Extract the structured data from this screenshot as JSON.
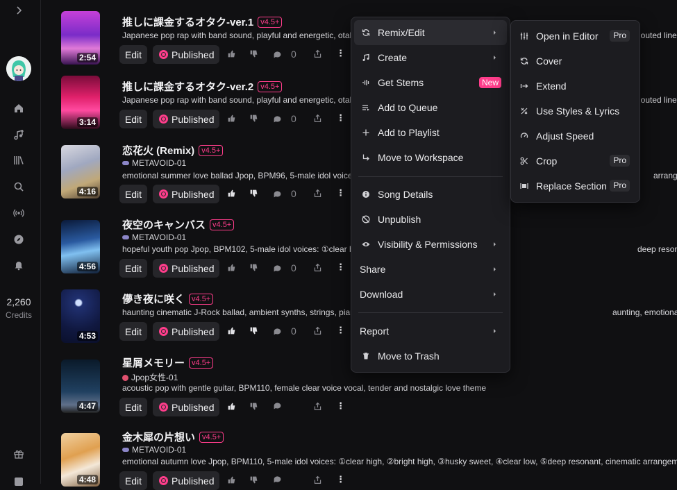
{
  "sidebar": {
    "items": [
      {
        "icon": "expand-chevron-icon"
      },
      {
        "icon": "home-icon"
      },
      {
        "icon": "create-music-icon"
      },
      {
        "icon": "library-icon"
      },
      {
        "icon": "search-icon"
      },
      {
        "icon": "radio-icon"
      },
      {
        "icon": "explore-compass-icon"
      },
      {
        "icon": "notifications-bell-icon"
      },
      {
        "icon": "gift-icon"
      },
      {
        "icon": "bottom-menu-icon"
      }
    ],
    "credits_value": "2,260",
    "credits_label": "Credits"
  },
  "songs": [
    {
      "title": "推しに課金するオタク-ver.1",
      "version": "v4.5+",
      "artist": "",
      "description": "Japanese pop rap with band sound, playful and energetic, otaku p",
      "description_tail": "houted lines",
      "duration": "2:54",
      "edit_label": "Edit",
      "published_label": "Published",
      "likes": "",
      "comments": "0"
    },
    {
      "title": "推しに課金するオタク-ver.2",
      "version": "v4.5+",
      "artist": "",
      "description": "Japanese pop rap with band sound, playful and energetic, otaku p",
      "description_tail": "houted lines",
      "duration": "3:14",
      "edit_label": "Edit",
      "published_label": "Published",
      "likes": "",
      "comments": "0"
    },
    {
      "title": "恋花火 (Remix)",
      "version": "v4.5+",
      "artist": "METAVOID-01",
      "description": "emotional summer love ballad Jpop, BPM96, 5-male idol voices: ①",
      "description_tail": "arrangeme",
      "duration": "4:16",
      "edit_label": "Edit",
      "published_label": "Published",
      "likes": "",
      "comments": "0"
    },
    {
      "title": "夜空のキャンバス",
      "version": "v4.5+",
      "artist": "METAVOID-01",
      "description": "hopeful youth pop Jpop, BPM102, 5-male idol voices: ①clear high",
      "description_tail": "deep resonant, cinematic arrangement, Chorus s",
      "duration": "4:56",
      "edit_label": "Edit",
      "published_label": "Published",
      "likes": "",
      "comments": "0"
    },
    {
      "title": "儚き夜に咲く",
      "version": "v4.5+",
      "artist": "",
      "description": "haunting cinematic J-Rock ballad, ambient synths, strings, piano, l",
      "description_tail": "aunting, emotionally intense J-rock ballad fused wi",
      "duration": "4:53",
      "edit_label": "Edit",
      "published_label": "Published",
      "likes": "",
      "comments": "0"
    },
    {
      "title": "星屑メモリー",
      "version": "v4.5+",
      "artist": "Jpop女性-01",
      "description": "acoustic pop with gentle guitar, BPM110, female clear voice vocal, tender and nostalgic love theme",
      "description_tail": "",
      "duration": "4:47",
      "edit_label": "Edit",
      "published_label": "Published",
      "likes": "",
      "comments": ""
    },
    {
      "title": "金木犀の片想い",
      "version": "v4.5+",
      "artist": "METAVOID-01",
      "description": "emotional autumn love Jpop, BPM110, 5-male idol voices: ①clear high, ②bright high, ③husky sweet, ④clear low, ⑤deep resonant, cinematic arrangement, Chor",
      "description_tail": "",
      "duration": "4:48",
      "edit_label": "Edit",
      "published_label": "Published",
      "likes": "",
      "comments": ""
    }
  ],
  "context_menu": {
    "items": [
      {
        "label": "Remix/Edit",
        "icon": "remix-icon",
        "submenu": true,
        "highlighted": true
      },
      {
        "label": "Create",
        "icon": "music-note-icon",
        "submenu": true
      },
      {
        "label": "Get Stems",
        "icon": "stems-icon",
        "badge": "New"
      },
      {
        "label": "Add to Queue",
        "icon": "queue-icon"
      },
      {
        "label": "Add to Playlist",
        "icon": "plus-icon"
      },
      {
        "label": "Move to Workspace",
        "icon": "move-arrow-icon"
      },
      {
        "label": "Song Details",
        "icon": "info-icon"
      },
      {
        "label": "Unpublish",
        "icon": "unpublish-icon"
      },
      {
        "label": "Visibility & Permissions",
        "icon": "eye-icon",
        "submenu": true
      },
      {
        "label": "Share",
        "submenu": true
      },
      {
        "label": "Download",
        "submenu": true
      },
      {
        "label": "Report",
        "submenu": true
      },
      {
        "label": "Move to Trash",
        "icon": "trash-icon"
      }
    ]
  },
  "submenu": {
    "items": [
      {
        "label": "Open in Editor",
        "icon": "sliders-icon",
        "badge": "Pro"
      },
      {
        "label": "Cover",
        "icon": "cover-icon"
      },
      {
        "label": "Extend",
        "icon": "extend-icon"
      },
      {
        "label": "Use Styles & Lyrics",
        "icon": "styles-icon"
      },
      {
        "label": "Adjust Speed",
        "icon": "speed-icon"
      },
      {
        "label": "Crop",
        "icon": "scissors-icon",
        "badge": "Pro"
      },
      {
        "label": "Replace Section",
        "icon": "replace-section-icon",
        "badge": "Pro"
      }
    ]
  },
  "colors": {
    "accent": "#ff3d8b",
    "background": "#101012",
    "menu_bg": "#1c1c20"
  }
}
